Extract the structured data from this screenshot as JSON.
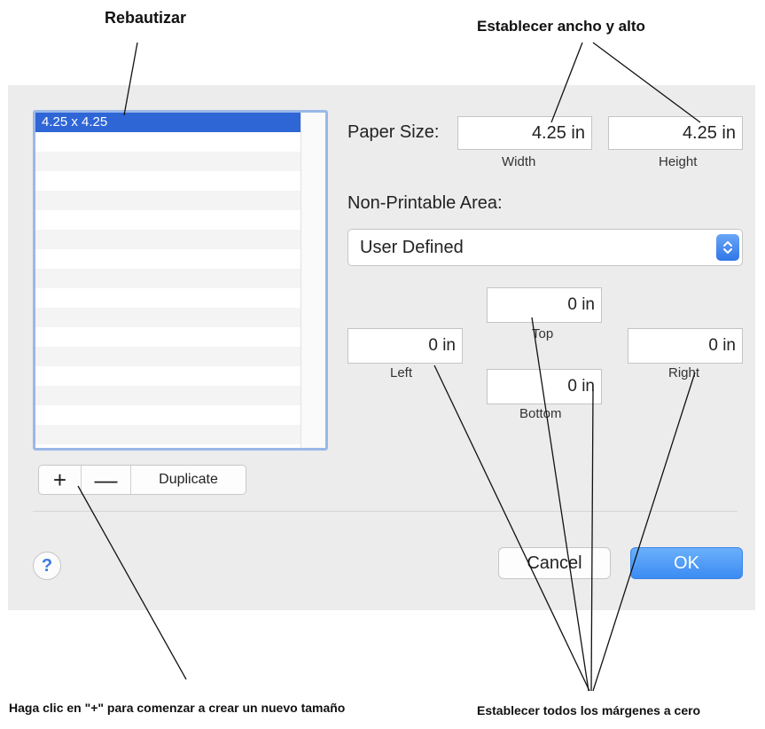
{
  "annotations": {
    "rename": "Rebautizar",
    "set_size": "Establecer ancho y alto",
    "click_plus": "Haga clic en \"+\" para comenzar a crear un nuevo tamaño",
    "zero_margins": "Establecer todos los márgenes a cero"
  },
  "sidebar": {
    "items": [
      {
        "label": "4.25 x 4.25",
        "selected": true
      }
    ]
  },
  "list_controls": {
    "add_label": "+",
    "remove_label": "—",
    "duplicate_label": "Duplicate"
  },
  "paper_size": {
    "label": "Paper Size:",
    "width_value": "4.25 in",
    "width_caption": "Width",
    "height_value": "4.25 in",
    "height_caption": "Height"
  },
  "non_printable": {
    "label": "Non-Printable Area:",
    "selected_option": "User Defined"
  },
  "margins": {
    "top_value": "0 in",
    "top_caption": "Top",
    "left_value": "0 in",
    "left_caption": "Left",
    "right_value": "0 in",
    "right_caption": "Right",
    "bottom_value": "0 in",
    "bottom_caption": "Bottom"
  },
  "footer": {
    "help_label": "?",
    "cancel_label": "Cancel",
    "ok_label": "OK"
  },
  "colors": {
    "selection": "#2f66d6",
    "accent": "#3b8bf2",
    "dialog_bg": "#ececec"
  }
}
